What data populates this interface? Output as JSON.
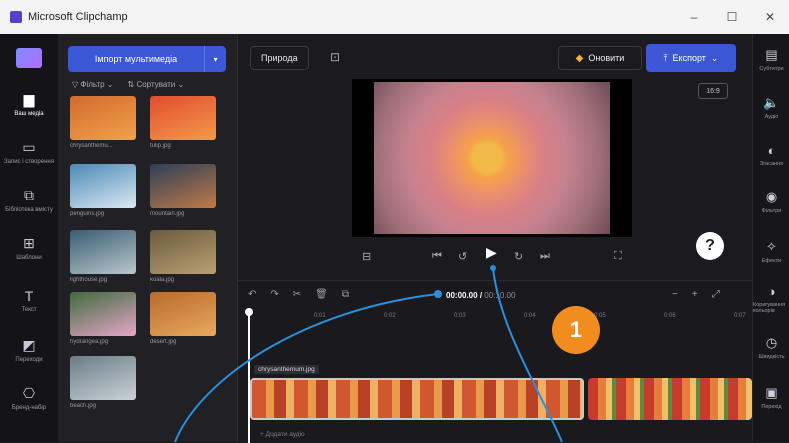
{
  "window": {
    "title": "Microsoft Clipchamp",
    "min": "–",
    "max": "☐",
    "close": "✕"
  },
  "left_rail": [
    {
      "label": "Ваш медіа",
      "icon": "▆"
    },
    {
      "label": "Запис і створення",
      "icon": "▭"
    },
    {
      "label": "Бібліотека вмісту",
      "icon": "⧉"
    },
    {
      "label": "Шаблони",
      "icon": "⊞"
    },
    {
      "label": "Текст",
      "icon": "T"
    },
    {
      "label": "Переходи",
      "icon": "◩"
    },
    {
      "label": "Бренд-набір",
      "icon": "⎔"
    }
  ],
  "media": {
    "import_label": "Імпорт мультимедіа",
    "filter_label": "Фільтр",
    "sort_label": "Сортувати",
    "items": [
      {
        "name": "chrysanthemu...",
        "colors": [
          "#d36a2f",
          "#f0a24a"
        ]
      },
      {
        "name": "tulip.jpg",
        "colors": [
          "#e24c2f",
          "#f39a4a"
        ]
      },
      {
        "name": "penguins.jpg",
        "colors": [
          "#4b89b6",
          "#dbe9f3"
        ]
      },
      {
        "name": "mountain.jpg",
        "colors": [
          "#2d3f57",
          "#c07a49"
        ]
      },
      {
        "name": "lighthouse.jpg",
        "colors": [
          "#3a5c73",
          "#b9c7cd"
        ]
      },
      {
        "name": "koala.jpg",
        "colors": [
          "#6b5a3d",
          "#b8a173"
        ]
      },
      {
        "name": "hydrangea.jpg",
        "colors": [
          "#3f6b3d",
          "#e6a6c9"
        ]
      },
      {
        "name": "desert.jpg",
        "colors": [
          "#b96a2c",
          "#e8a95f"
        ]
      },
      {
        "name": "beach.jpg",
        "colors": [
          "#6b7c88",
          "#c9d2d6"
        ]
      }
    ]
  },
  "topbar": {
    "project_name": "Природа",
    "upgrade_label": "Оновити",
    "export_label": "Експорт"
  },
  "preview": {
    "aspect_ratio": "16:9"
  },
  "timeline": {
    "current_time": "00:00.00",
    "duration": "00:10.00",
    "ruler_marks": [
      "0:01",
      "0:02",
      "0:03",
      "0:04",
      "0:05",
      "0:06",
      "0:07"
    ],
    "clip_name": "chrysanthemum.jpg",
    "audio_hint": "+ Додати аудіо"
  },
  "right_rail": [
    {
      "label": "Субтитри",
      "icon": "▤"
    },
    {
      "label": "Аудіо",
      "icon": "🔈"
    },
    {
      "label": "Згасання",
      "icon": "◐"
    },
    {
      "label": "Фільтри",
      "icon": "◉"
    },
    {
      "label": "Ефекти",
      "icon": "✧"
    },
    {
      "label": "Коригування кольорів",
      "icon": "◑"
    },
    {
      "label": "Швидкість",
      "icon": "◷"
    },
    {
      "label": "Перехід",
      "icon": "▣"
    }
  ],
  "callout": {
    "number": "1"
  },
  "help": {
    "label": "?"
  }
}
